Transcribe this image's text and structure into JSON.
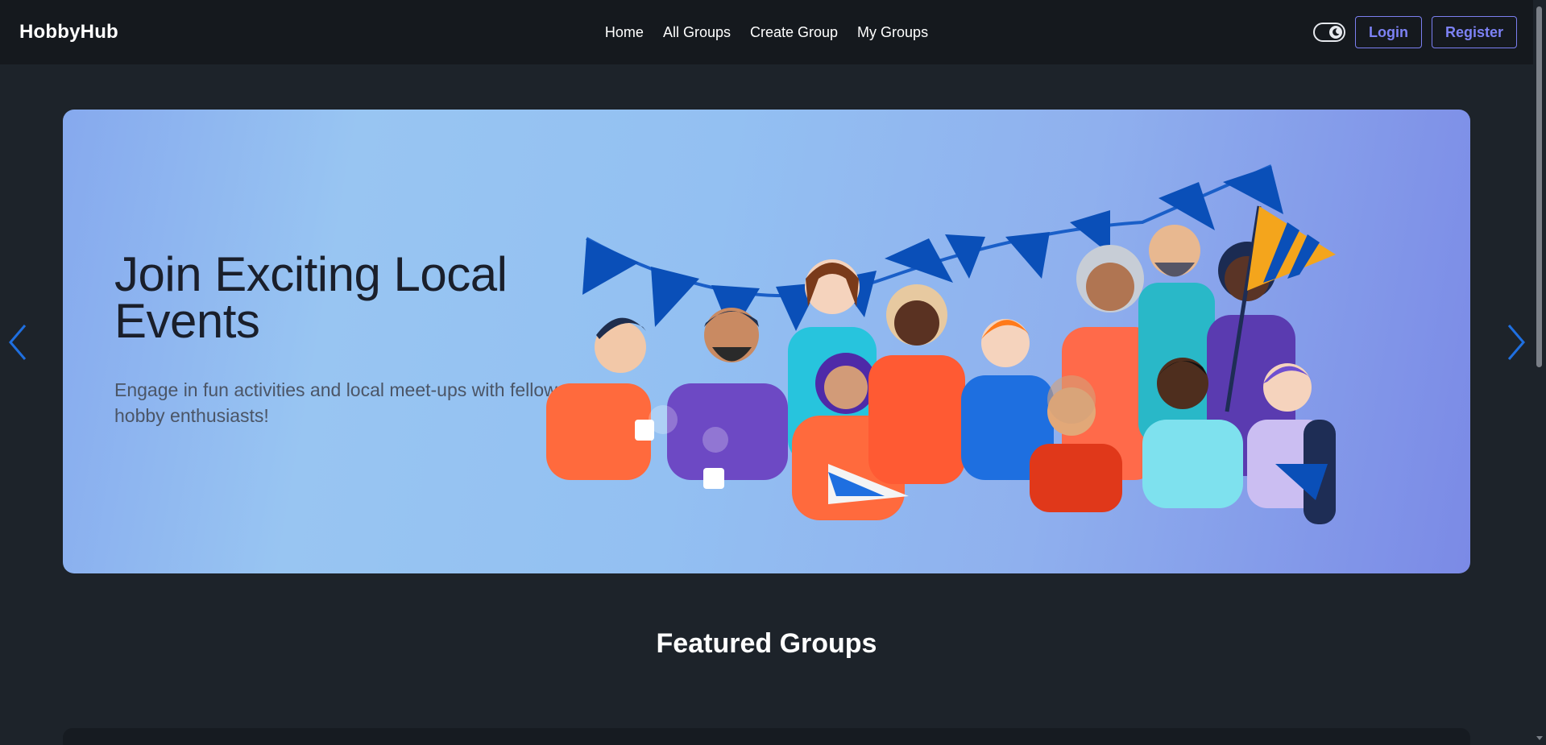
{
  "brand": "HobbyHub",
  "nav": {
    "links": [
      "Home",
      "All Groups",
      "Create Group",
      "My Groups"
    ],
    "login": "Login",
    "register": "Register",
    "theme_icon": "moon-icon"
  },
  "hero": {
    "title": "Join Exciting Local Events",
    "subtitle": "Engage in fun activities and local meet-ups with fellow hobby enthusiasts!",
    "prev_icon": "chevron-left-icon",
    "next_icon": "chevron-right-icon"
  },
  "featured": {
    "title": "Featured Groups"
  },
  "colors": {
    "page_bg": "#1d232a",
    "navbar_bg": "#15191e",
    "accent": "#7d82f5",
    "carousel_arrow": "#1f6fe0"
  }
}
